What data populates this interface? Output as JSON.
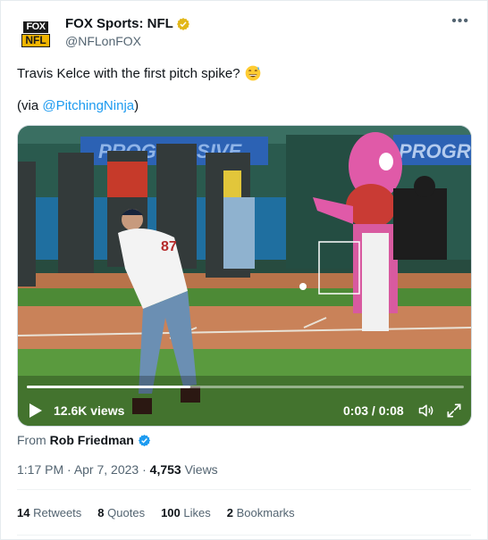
{
  "author": {
    "logo_top": "FOX",
    "logo_bottom": "NFL",
    "name": "FOX Sports: NFL",
    "handle": "@NFLonFOX"
  },
  "tweet": {
    "text": "Travis Kelce with the first pitch spike?",
    "emoji": "grinning-sweat-emoji",
    "via_prefix": "(via ",
    "via_handle": "@PitchingNinja",
    "via_suffix": ")"
  },
  "video": {
    "views": "12.6K views",
    "time": "0:03 / 0:08",
    "progress": 0.375,
    "scene_text": {
      "banner_left": "PROGRESSIVE",
      "banner_right": "PROGR",
      "jersey_number": "87"
    }
  },
  "source": {
    "prefix": "From",
    "name": "Rob Friedman"
  },
  "meta": {
    "time": "1:17 PM",
    "date": "Apr 7, 2023",
    "views_count": "4,753",
    "views_label": "Views"
  },
  "stats": [
    {
      "count": "14",
      "label": "Retweets"
    },
    {
      "count": "8",
      "label": "Quotes"
    },
    {
      "count": "100",
      "label": "Likes"
    },
    {
      "count": "2",
      "label": "Bookmarks"
    }
  ],
  "colors": {
    "link": "#1d9bf0",
    "muted": "#536471",
    "verified_gold": "#e2b719",
    "verified_blue": "#1d9bf0"
  }
}
